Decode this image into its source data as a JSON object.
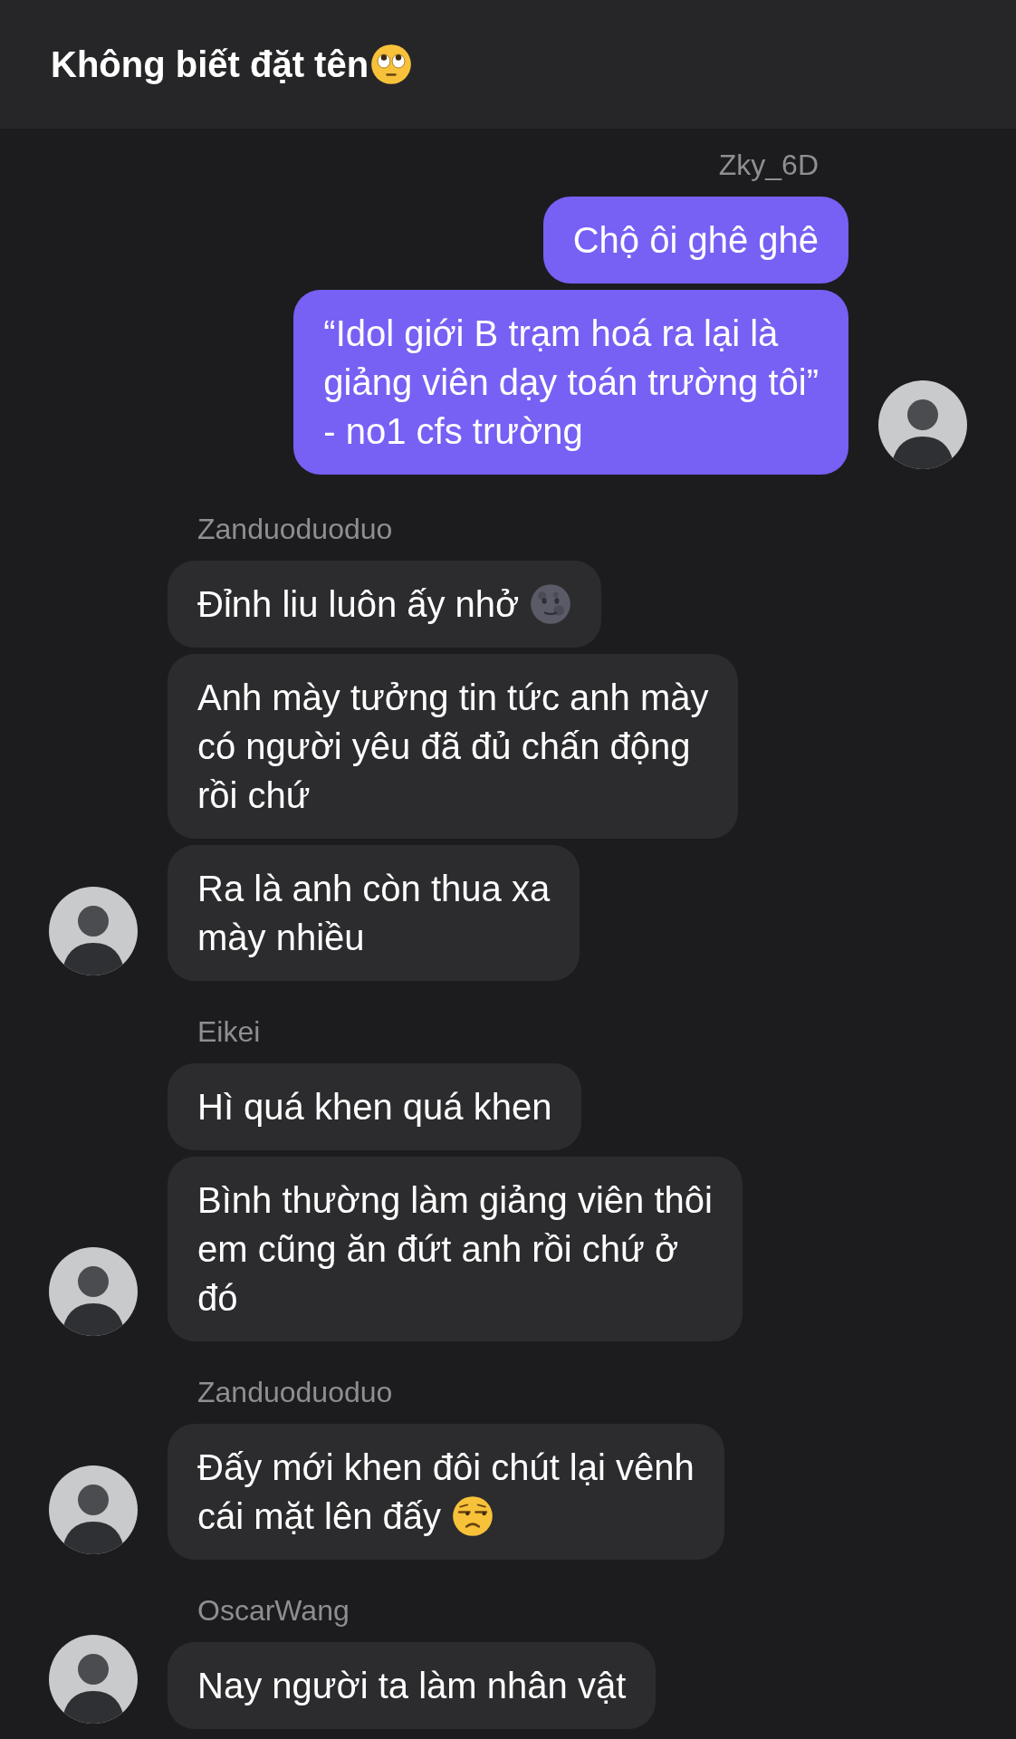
{
  "header": {
    "title": "Không biết đặt tên",
    "emoji": {
      "kind": "rolling-eyes"
    }
  },
  "groups": [
    {
      "kind": "outgoing",
      "sender": "Zky_6D",
      "messages": [
        {
          "lines": [
            "Chộ ôi ghê ghê"
          ]
        },
        {
          "lines": [
            "“Idol giới B trạm hoá ra lại là",
            "giảng viên dạy toán trường tôi”",
            "- no1 cfs trường"
          ]
        }
      ]
    },
    {
      "kind": "incoming",
      "sender": "Zanduoduoduo",
      "messages": [
        {
          "lines": [
            "Đỉnh liu luôn ấy nhở"
          ],
          "emoji": {
            "kind": "new-moon"
          }
        },
        {
          "lines": [
            "Anh mày tưởng tin tức anh mày",
            "có người yêu đã đủ chấn động",
            "rồi chứ"
          ]
        },
        {
          "lines": [
            "Ra là anh còn thua xa",
            "mày nhiều"
          ]
        }
      ]
    },
    {
      "kind": "incoming",
      "sender": "Eikei",
      "messages": [
        {
          "lines": [
            "Hì quá khen quá khen"
          ]
        },
        {
          "lines": [
            "Bình thường làm giảng viên thôi",
            "em cũng ăn đứt anh rồi chứ ở",
            "đó"
          ]
        }
      ]
    },
    {
      "kind": "incoming",
      "sender": "Zanduoduoduo",
      "messages": [
        {
          "lines": [
            "Đấy mới khen đôi chút lại vênh",
            "cái mặt lên đấy"
          ],
          "emoji": {
            "kind": "unamused"
          }
        }
      ]
    },
    {
      "kind": "incoming",
      "sender": "OscarWang",
      "messages": [
        {
          "lines": [
            "Nay người ta làm nhân vật"
          ]
        }
      ]
    }
  ]
}
